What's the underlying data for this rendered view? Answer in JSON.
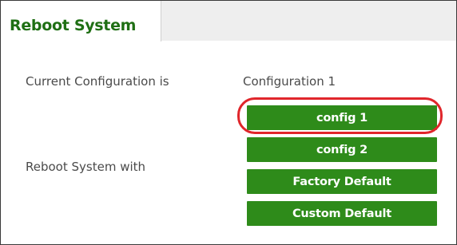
{
  "tab": {
    "title": "Reboot System"
  },
  "current_configuration": {
    "label": "Current Configuration is",
    "value": "Configuration 1"
  },
  "reboot_with": {
    "label": "Reboot System with",
    "buttons": [
      {
        "label": "config 1",
        "highlighted": true
      },
      {
        "label": "config 2",
        "highlighted": false
      },
      {
        "label": "Factory Default",
        "highlighted": false
      },
      {
        "label": "Custom Default",
        "highlighted": false
      }
    ]
  },
  "colors": {
    "tab_title": "#1f6f14",
    "button_bg": "#2e8b1a",
    "button_text": "#ffffff",
    "highlight_outline": "#e0262b",
    "label_text": "#4a4a4a",
    "tab_bar_bg": "#eeeeee"
  }
}
